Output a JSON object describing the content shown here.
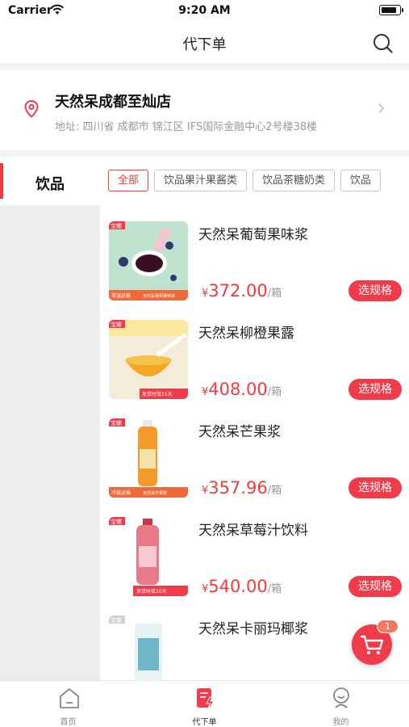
{
  "status_bar": {
    "carrier": "Carrier",
    "time": "9:20 AM"
  },
  "nav": {
    "title": "代下单",
    "search_icon": "search-icon"
  },
  "store": {
    "name": "天然呆成都至灿店",
    "address": "地址: 四川省 成都市 锦江区 IFS国际金融中心2号楼38楼"
  },
  "sidebar": {
    "active_category": "饮品"
  },
  "chips": [
    "全部",
    "饮品果汁果酱类",
    "饮品茶糖奶类",
    "饮品"
  ],
  "products": [
    {
      "name": "天然呆葡萄果味浆",
      "currency": "¥",
      "price": "372.00",
      "unit": "/箱",
      "button": "选规格",
      "tag": "常温运输",
      "subtag": "天然呆葡萄果味浆",
      "color": "#3a0d22"
    },
    {
      "name": "天然呆柳橙果露",
      "currency": "¥",
      "price": "408.00",
      "unit": "/箱",
      "button": "选规格",
      "tag": "发货时效15天",
      "subtag": "",
      "color": "#f3a722"
    },
    {
      "name": "天然呆芒果浆",
      "currency": "¥",
      "price": "357.96",
      "unit": "/箱",
      "button": "选规格",
      "tag": "冷链运输",
      "subtag": "天然呆芒果浆",
      "color": "#f29b2b"
    },
    {
      "name": "天然呆草莓汁饮料",
      "currency": "¥",
      "price": "540.00",
      "unit": "/箱",
      "button": "选规格",
      "tag": "发货时效20天",
      "subtag": "",
      "color": "#e77a86"
    },
    {
      "name": "天然呆卡丽玛椰浆",
      "currency": "¥",
      "price": "",
      "unit": "",
      "button": "",
      "tag": "",
      "subtag": "",
      "color": "#6fb7c9"
    }
  ],
  "thumb_badge": "宝螺",
  "cart": {
    "count": "1"
  },
  "tabs": [
    {
      "label": "首页",
      "icon": "home-icon"
    },
    {
      "label": "代下单",
      "icon": "order-icon"
    },
    {
      "label": "我的",
      "icon": "profile-icon"
    }
  ],
  "colors": {
    "accent": "#ef3b3b",
    "button": "#ef3b4a",
    "divider": "#f3f3f3",
    "sidebar_bg": "#ececec"
  }
}
